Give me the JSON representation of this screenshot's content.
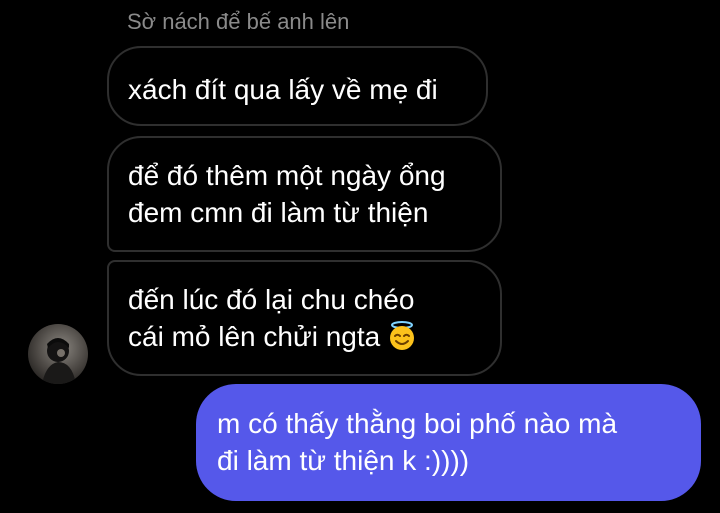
{
  "conversation": {
    "reply_context": "Sờ nách để bế anh lên",
    "messages": [
      {
        "sender": "them",
        "lines": [
          "xách đít qua lấy về mẹ đi"
        ]
      },
      {
        "sender": "them",
        "lines": [
          "để đó thêm một ngày ổng",
          "đem cmn đi làm từ thiện"
        ]
      },
      {
        "sender": "them",
        "lines": [
          "đến lúc đó lại chu chéo",
          "cái mỏ lên chửi ngta"
        ],
        "emoji": "smiling-face-with-halo-icon"
      },
      {
        "sender": "me",
        "lines": [
          "m có thấy thằng boi phố nào mà",
          "đi làm từ thiện k :))))"
        ]
      }
    ]
  },
  "colors": {
    "background": "#000000",
    "incoming_border": "#2f2f2f",
    "outgoing_bubble": "#5558ea",
    "reply_context_text": "#8a8a8a",
    "message_text": "#ffffff"
  },
  "avatar": {
    "icon": "profile-photo-avatar"
  }
}
